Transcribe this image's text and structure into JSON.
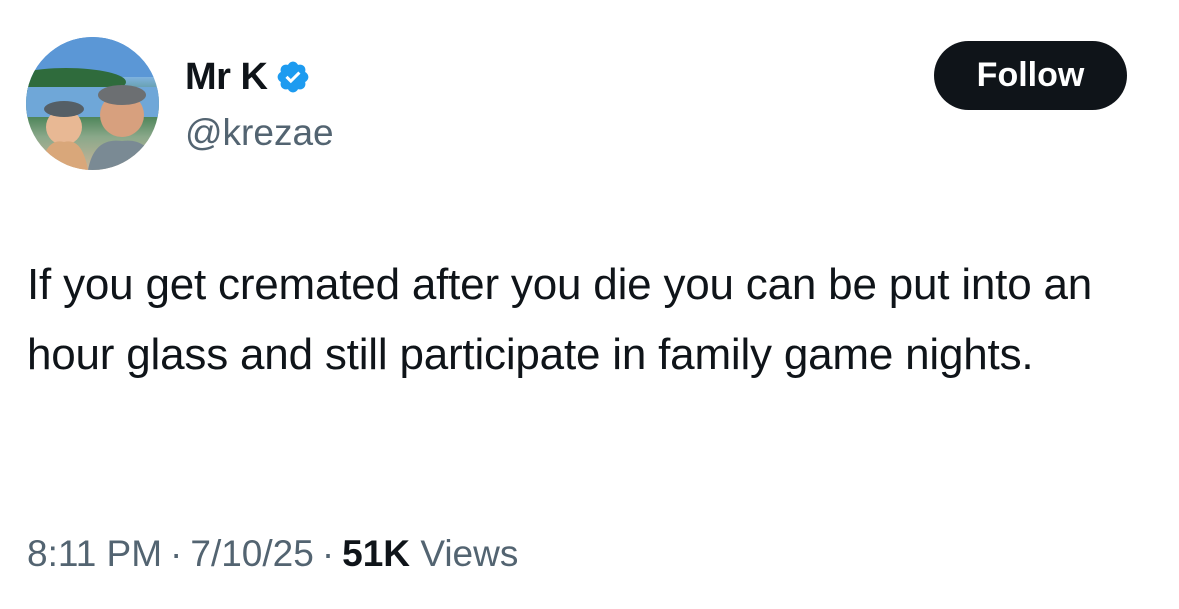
{
  "author": {
    "display_name": "Mr K",
    "handle": "@krezae",
    "verified": true,
    "verified_color": "#1d9bf0"
  },
  "follow_button": {
    "label": "Follow",
    "background": "#0f1419"
  },
  "tweet": {
    "text": "If you get cremated after you die you can be put into an hour glass and still participate in family game nights."
  },
  "meta": {
    "time": "8:11 PM",
    "separator": "·",
    "date": "7/10/25",
    "views_count": "51K",
    "views_label": "Views"
  }
}
